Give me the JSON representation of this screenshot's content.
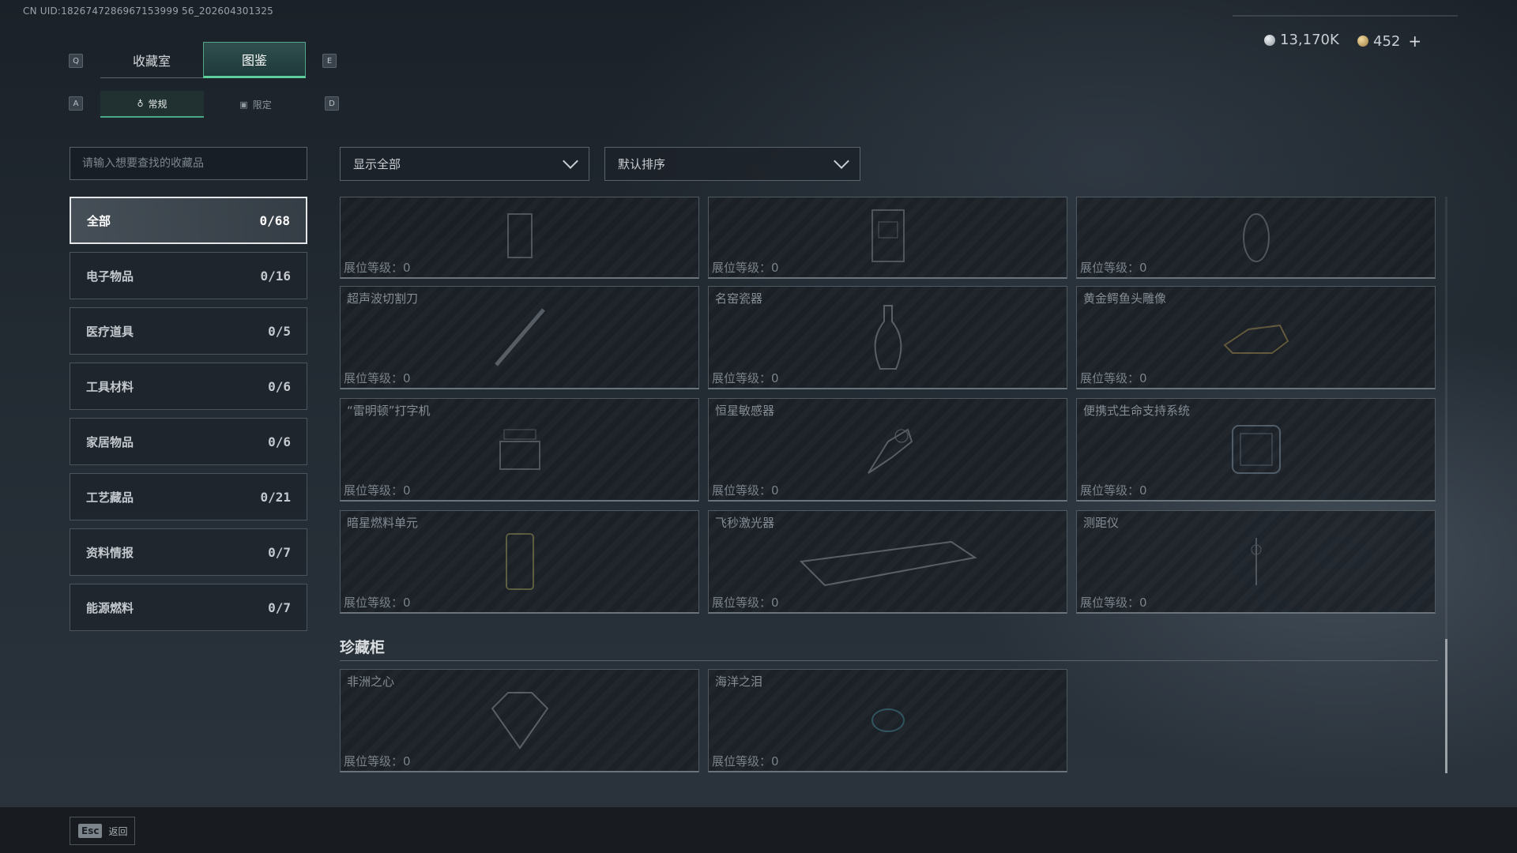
{
  "uid": "CN UID:1826747286967153999 56_202604301325",
  "currency": {
    "silver": "13,170K",
    "gold": "452",
    "add": "+"
  },
  "keys": {
    "q": "Q",
    "e": "E",
    "a": "A",
    "d": "D"
  },
  "tabs": {
    "collection_room": "收藏室",
    "codex": "图鉴"
  },
  "subtabs": {
    "regular": "常规",
    "limited": "限定"
  },
  "search": {
    "placeholder": "请输入想要查找的收藏品"
  },
  "categories": [
    {
      "label": "全部",
      "count": "0/68"
    },
    {
      "label": "电子物品",
      "count": "0/16"
    },
    {
      "label": "医疗道具",
      "count": "0/5"
    },
    {
      "label": "工具材料",
      "count": "0/6"
    },
    {
      "label": "家居物品",
      "count": "0/6"
    },
    {
      "label": "工艺藏品",
      "count": "0/21"
    },
    {
      "label": "资料情报",
      "count": "0/7"
    },
    {
      "label": "能源燃料",
      "count": "0/7"
    }
  ],
  "filters": {
    "show": "显示全部",
    "sort": "默认排序"
  },
  "items": [
    {
      "name": "",
      "level": "展位等级：0",
      "icon": "item-icon"
    },
    {
      "name": "",
      "level": "展位等级：0",
      "icon": "item-icon"
    },
    {
      "name": "",
      "level": "展位等级：0",
      "icon": "item-icon"
    },
    {
      "name": "超声波切割刀",
      "level": "展位等级：0",
      "icon": "knife-icon"
    },
    {
      "name": "名窑瓷器",
      "level": "展位等级：0",
      "icon": "vase-icon"
    },
    {
      "name": "黄金鳄鱼头雕像",
      "level": "展位等级：0",
      "icon": "statue-icon"
    },
    {
      "name": "“雷明顿”打字机",
      "level": "展位等级：0",
      "icon": "typewriter-icon"
    },
    {
      "name": "恒星敏感器",
      "level": "展位等级：0",
      "icon": "sensor-icon"
    },
    {
      "name": "便携式生命支持系统",
      "level": "展位等级：0",
      "icon": "life-support-icon"
    },
    {
      "name": "暗星燃料单元",
      "level": "展位等级：0",
      "icon": "fuel-cell-icon"
    },
    {
      "name": "飞秒激光器",
      "level": "展位等级：0",
      "icon": "laser-icon"
    },
    {
      "name": "测距仪",
      "level": "展位等级：0",
      "icon": "rangefinder-icon"
    }
  ],
  "treasure": {
    "title": "珍藏柜",
    "items": [
      {
        "name": "非洲之心",
        "level": "展位等级：0",
        "icon": "diamond-icon"
      },
      {
        "name": "海洋之泪",
        "level": "展位等级：0",
        "icon": "gem-icon"
      }
    ]
  },
  "footer": {
    "esc_key": "Esc",
    "back": "返回"
  }
}
